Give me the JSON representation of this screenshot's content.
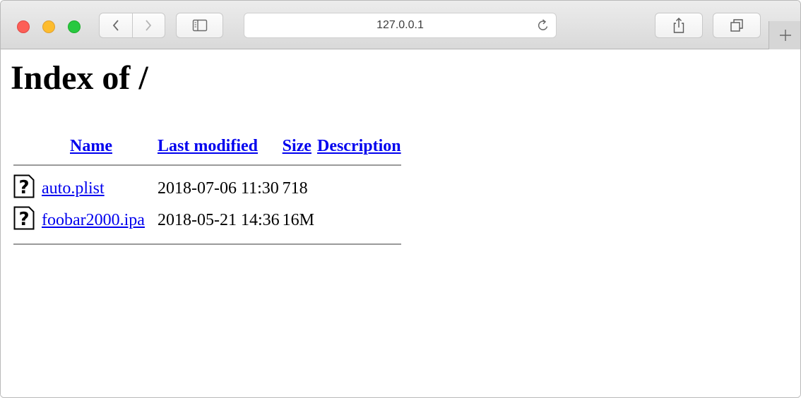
{
  "browser": {
    "url": "127.0.0.1",
    "buttons": {
      "back": "chevron-left-icon",
      "forward": "chevron-right-icon",
      "sidebar": "sidebar-icon",
      "reload": "reload-icon",
      "share": "share-icon",
      "tabs": "tab-overview-icon",
      "new_tab": "plus-icon"
    },
    "colors": {
      "close": "#fc5f57",
      "minimize": "#fdbc2e",
      "maximize": "#28c840"
    }
  },
  "page": {
    "title": "Index of /",
    "columns": {
      "name": "Name",
      "last_modified": "Last modified",
      "size": "Size",
      "description": "Description"
    },
    "files": [
      {
        "icon": "unknown-file-icon",
        "name": "auto.plist",
        "modified": "2018-07-06 11:30",
        "size": "718",
        "description": ""
      },
      {
        "icon": "unknown-file-icon",
        "name": "foobar2000.ipa",
        "modified": "2018-05-21 14:36",
        "size": "16M",
        "description": ""
      }
    ],
    "link_color": "#0000ee"
  }
}
